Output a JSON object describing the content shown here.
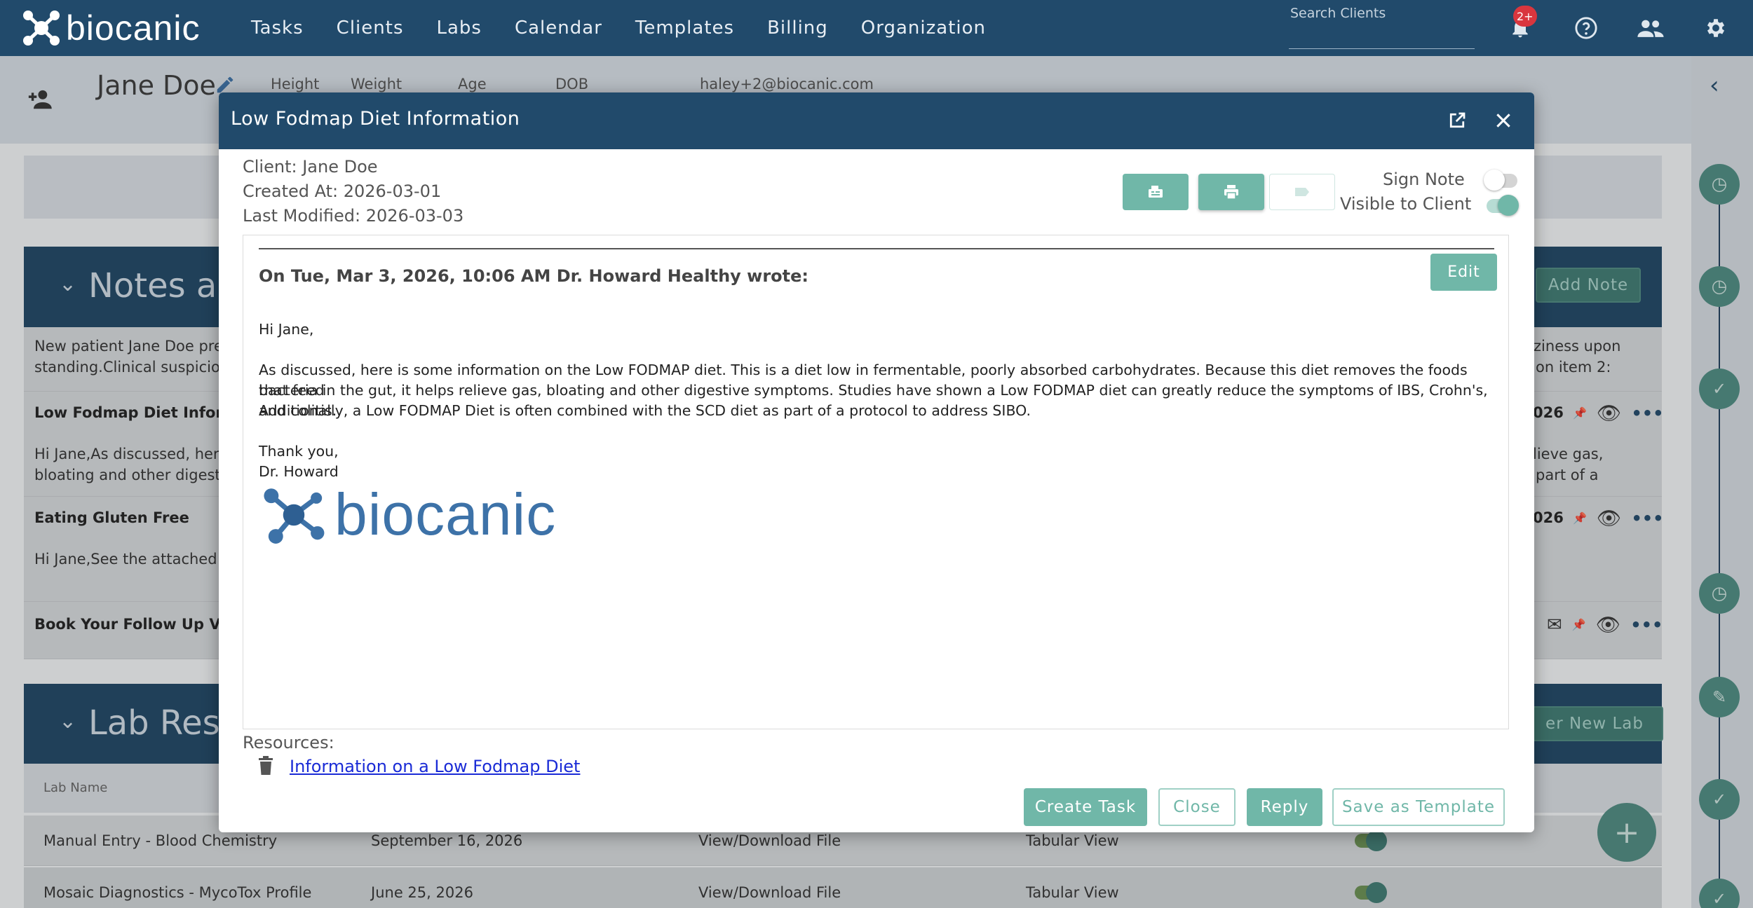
{
  "app": {
    "logo_text": "biocanic",
    "nav": [
      "Tasks",
      "Clients",
      "Labs",
      "Calendar",
      "Templates",
      "Billing",
      "Organization"
    ],
    "search_label": "Search Clients",
    "search_value": "",
    "notification_badge": "2+"
  },
  "client": {
    "name": "Jane Doe",
    "labels": {
      "height": "Height",
      "weight": "Weight",
      "age": "Age",
      "dob": "DOB",
      "email": "haley+2@biocanic.com"
    }
  },
  "notes_section": {
    "title": "Notes and",
    "add_note": "Add Note",
    "intro_left_1": "New patient Jane Doe pres",
    "intro_left_2": "standing.Clinical suspicion",
    "intro_right_1": "zziness upon",
    "intro_right_2": "on item 2:",
    "rows": [
      {
        "title": "Low Fodmap Diet Informat",
        "date": "026",
        "snippet_1": "Hi Jane,As discussed, here",
        "snippet_2": "bloating and other digestiv",
        "right_1": "lieve gas,",
        "right_2": "part of a"
      },
      {
        "title": "Eating Gluten Free",
        "date": "026",
        "snippet_1": "Hi Jane,See the attached in"
      },
      {
        "title": "Book Your Follow Up Visit"
      }
    ]
  },
  "labs_section": {
    "title": "Lab Result",
    "order_btn": "er New Lab",
    "col_lab_name": "Lab Name",
    "rows": [
      {
        "name": "Manual Entry - Blood Chemistry",
        "date": "September 16, 2026",
        "file": "View/Download File",
        "view": "Tabular View"
      },
      {
        "name": "Mosaic Diagnostics - MycoTox Profile",
        "date": "June 25, 2026",
        "file": "View/Download File",
        "view": "Tabular View"
      }
    ]
  },
  "modal": {
    "title": "Low Fodmap Diet Information",
    "client_line": "Client: Jane Doe",
    "created_line": "Created At: 2026-03-01",
    "modified_line": "Last Modified: 2026-03-03",
    "sign_note": "Sign Note",
    "visible_to_client": "Visible to Client",
    "sign_note_on": false,
    "visible_on": true,
    "wrote_line": "On Tue, Mar 3, 2026, 10:06 AM Dr. Howard Healthy wrote:",
    "edit": "Edit",
    "greeting": "Hi Jane,",
    "body_1": "As discussed, here is some information on the Low FODMAP diet. This is a diet low in fermentable, poorly absorbed carbohydrates. Because this diet removes the foods that feed",
    "body_2": "bacteria in the gut, it helps relieve gas, bloating and other digestive symptoms. Studies have shown a Low FODMAP diet can greatly reduce the symptoms of IBS, Crohn's, and colitis.",
    "body_3": "Additionally, a Low FODMAP Diet is often combined with the SCD diet as part of a protocol to address SIBO.",
    "thanks": "Thank you,",
    "signer": "Dr. Howard",
    "signature_logo_text": "biocanic",
    "resources_label": "Resources:",
    "resource_link": "Information on a Low Fodmap Diet",
    "buttons": {
      "create_task": "Create Task",
      "close": "Close",
      "reply": "Reply",
      "save_template": "Save as Template"
    }
  },
  "colors": {
    "navy": "#214a6b",
    "teal": "#70b7a8",
    "link": "#1a2bd6",
    "badge": "#d9363e"
  }
}
